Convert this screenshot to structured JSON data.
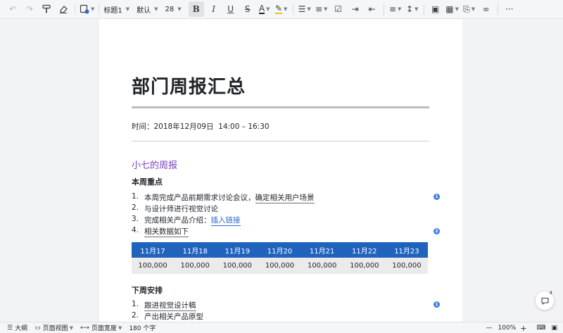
{
  "toolbar": {
    "undo_icon": "↶",
    "redo_icon": "↷",
    "format_painter_icon": "🖌",
    "clear_format_icon": "⌫",
    "insert_icon": "⊕",
    "style_value": "标题1",
    "font_value": "默认",
    "size_value": "28",
    "bold": "B",
    "italic": "I",
    "underline": "U",
    "strike": "S",
    "font_color": "A",
    "highlight": "✎",
    "bullet_list": "☰",
    "numbered_list": "≡",
    "checkbox": "☑",
    "indent": "⇥",
    "outdent": "⇤",
    "align": "≡",
    "line_spacing": "↕",
    "image": "▣",
    "table": "▦",
    "attachment": "⎘",
    "link": "∞",
    "more": "···"
  },
  "doc": {
    "title": "部门周报汇总",
    "time_label": "时间：",
    "time_date": "2018年12月09日",
    "time_range": "14:00 – 16:30",
    "author_heading": "小七的周报",
    "section1_heading": "本周重点",
    "section1_items": [
      {
        "num": "1.",
        "pre": "本周完成产品前期需求讨论会议，",
        "marked": "确定相关用户场景"
      },
      {
        "num": "2.",
        "pre": "与设计师进行视觉讨论",
        "marked": ""
      },
      {
        "num": "3.",
        "pre": "完成相关产品介绍：",
        "link": "插入链接"
      },
      {
        "num": "4.",
        "pre": "",
        "marked": "相关数据如下"
      }
    ],
    "comment_badges": [
      "1",
      "2",
      "1"
    ],
    "table_headers": [
      "11月17",
      "11月18",
      "11月19",
      "11月20",
      "11月21",
      "11月22",
      "11月23"
    ],
    "table_values": [
      "100,000",
      "100,000",
      "100,000",
      "100,000",
      "100,000",
      "100,000",
      "100,000"
    ],
    "section2_heading": "下周安排",
    "section2_items": [
      {
        "num": "1.",
        "marked": "跟进视觉设计稿"
      },
      {
        "num": "2.",
        "marked": "产出相关产品原型"
      }
    ]
  },
  "float_button": {
    "icon": "💬",
    "count": "4"
  },
  "statusbar": {
    "outline": "大纲",
    "page_view": "页面视图",
    "page_width": "页面宽度",
    "word_count": "180 个字",
    "zoom_out": "—",
    "zoom": "100%",
    "zoom_in": "+"
  },
  "colors": {
    "accent": "#1f63bc",
    "author": "#7a3ec0",
    "badge": "#3d7fe6"
  }
}
